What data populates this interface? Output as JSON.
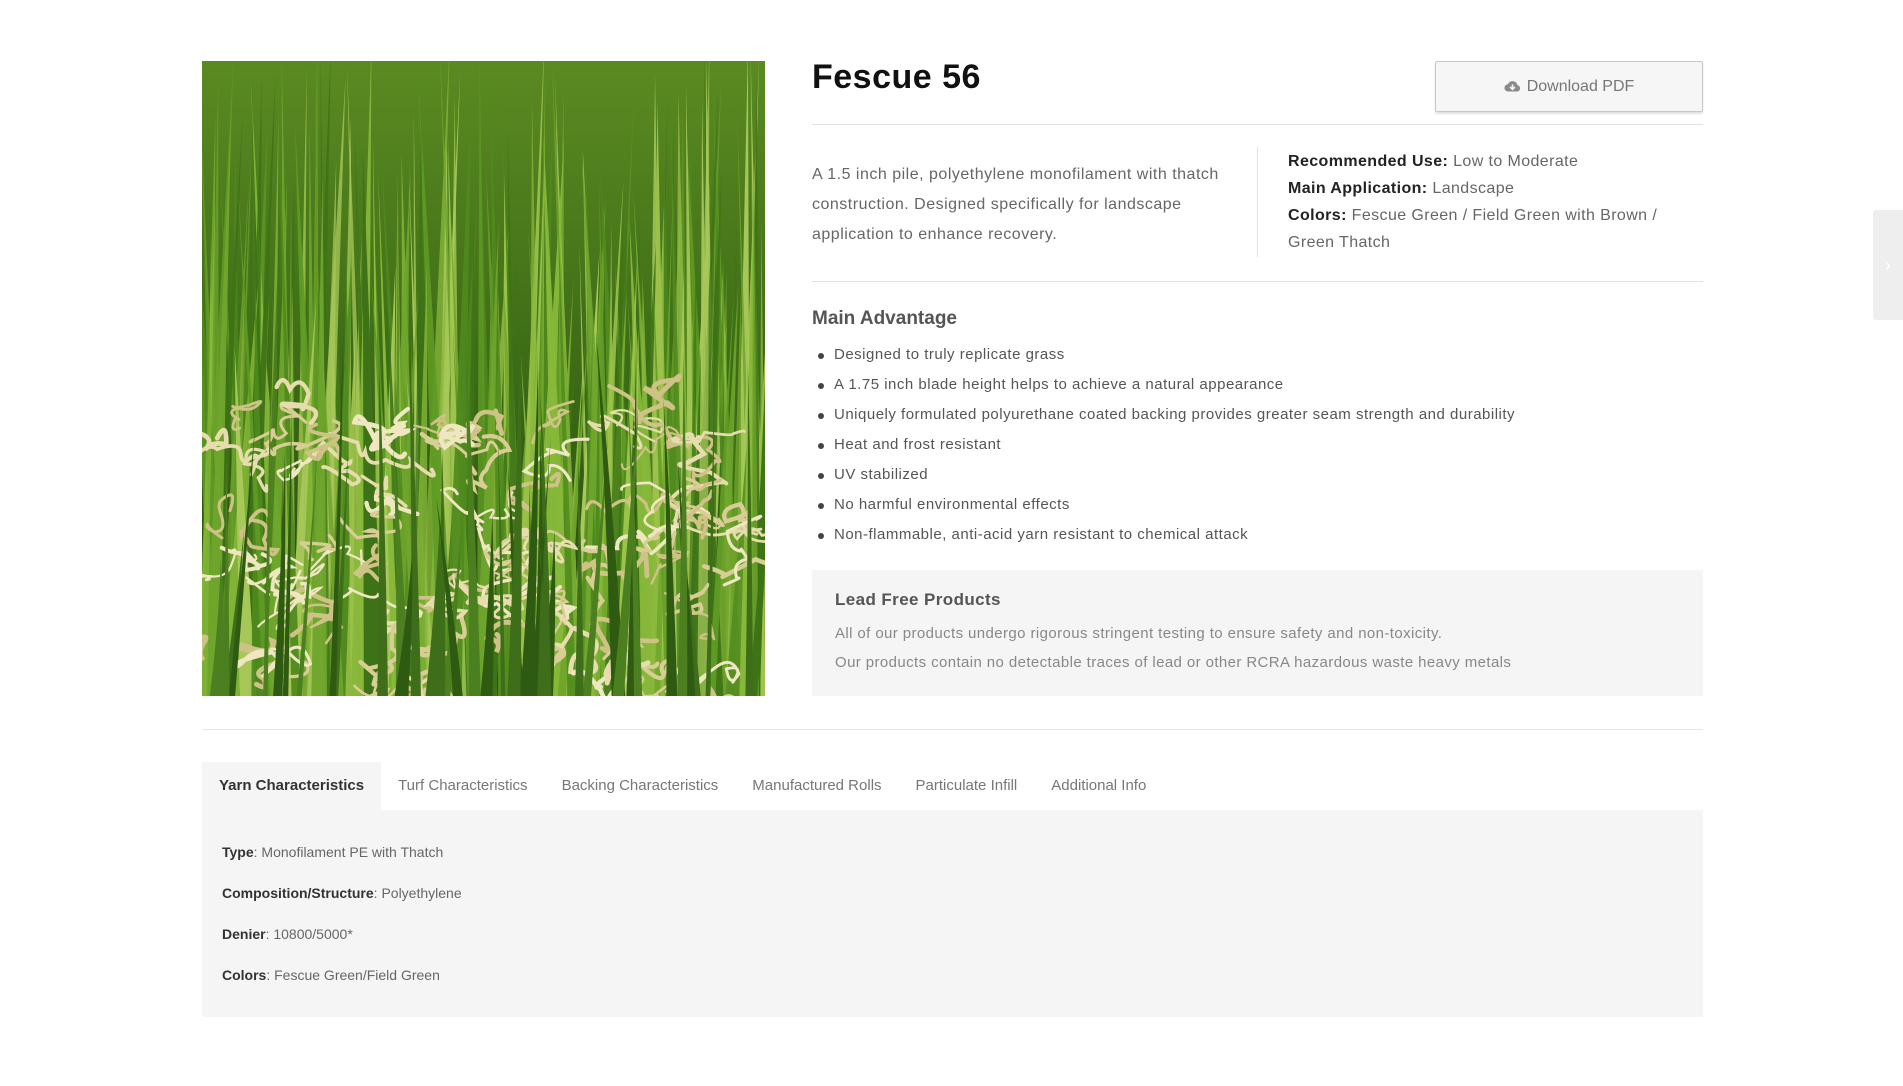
{
  "product": {
    "title": "Fescue 56",
    "image_alt": "Fescue 56 artificial turf close-up",
    "download_label": "Download PDF",
    "description": "A 1.5 inch pile, polyethylene monofilament with thatch construction. Designed specifically for landscape application to enhance recovery.",
    "specs": {
      "recommended_use_label": "Recommended Use:",
      "recommended_use_value": "Low to Moderate",
      "main_application_label": "Main Application:",
      "main_application_value": "Landscape",
      "colors_label": "Colors:",
      "colors_value": "Fescue Green / Field Green with Brown / Green Thatch"
    }
  },
  "advantage": {
    "title": "Main Advantage",
    "items": [
      "Designed to truly replicate grass",
      "A 1.75 inch blade height helps to achieve a natural appearance",
      "Uniquely formulated polyurethane coated backing provides greater seam strength and durability",
      "Heat and frost resistant",
      "UV stabilized",
      "No harmful environmental effects",
      "Non-flammable, anti-acid yarn resistant to chemical attack"
    ]
  },
  "lead_free": {
    "title": "Lead Free Products",
    "line1": "All of our products undergo rigorous stringent testing to ensure safety and non-toxicity.",
    "line2": "Our products contain no detectable traces of lead or other RCRA hazardous waste heavy metals"
  },
  "tabs": [
    {
      "label": "Yarn Characteristics",
      "active": true
    },
    {
      "label": "Turf Characteristics",
      "active": false
    },
    {
      "label": "Backing Characteristics",
      "active": false
    },
    {
      "label": "Manufactured Rolls",
      "active": false
    },
    {
      "label": "Particulate Infill",
      "active": false
    },
    {
      "label": "Additional Info",
      "active": false
    }
  ],
  "yarn": {
    "type_label": "Type",
    "type_value": ": Monofilament PE with Thatch",
    "composition_label": "Composition/Structure",
    "composition_value": ": Polyethylene",
    "denier_label": "Denier",
    "denier_value": ": 10800/5000*",
    "colors_label": "Colors",
    "colors_value": ": Fescue Green/Field Green"
  },
  "icons": {
    "download": "cloud-download-icon",
    "side_handle": "chevron-right-icon"
  },
  "colors": {
    "accent_text": "#111111",
    "panel_bg": "#f5f5f5",
    "border": "#e2e2e2"
  }
}
